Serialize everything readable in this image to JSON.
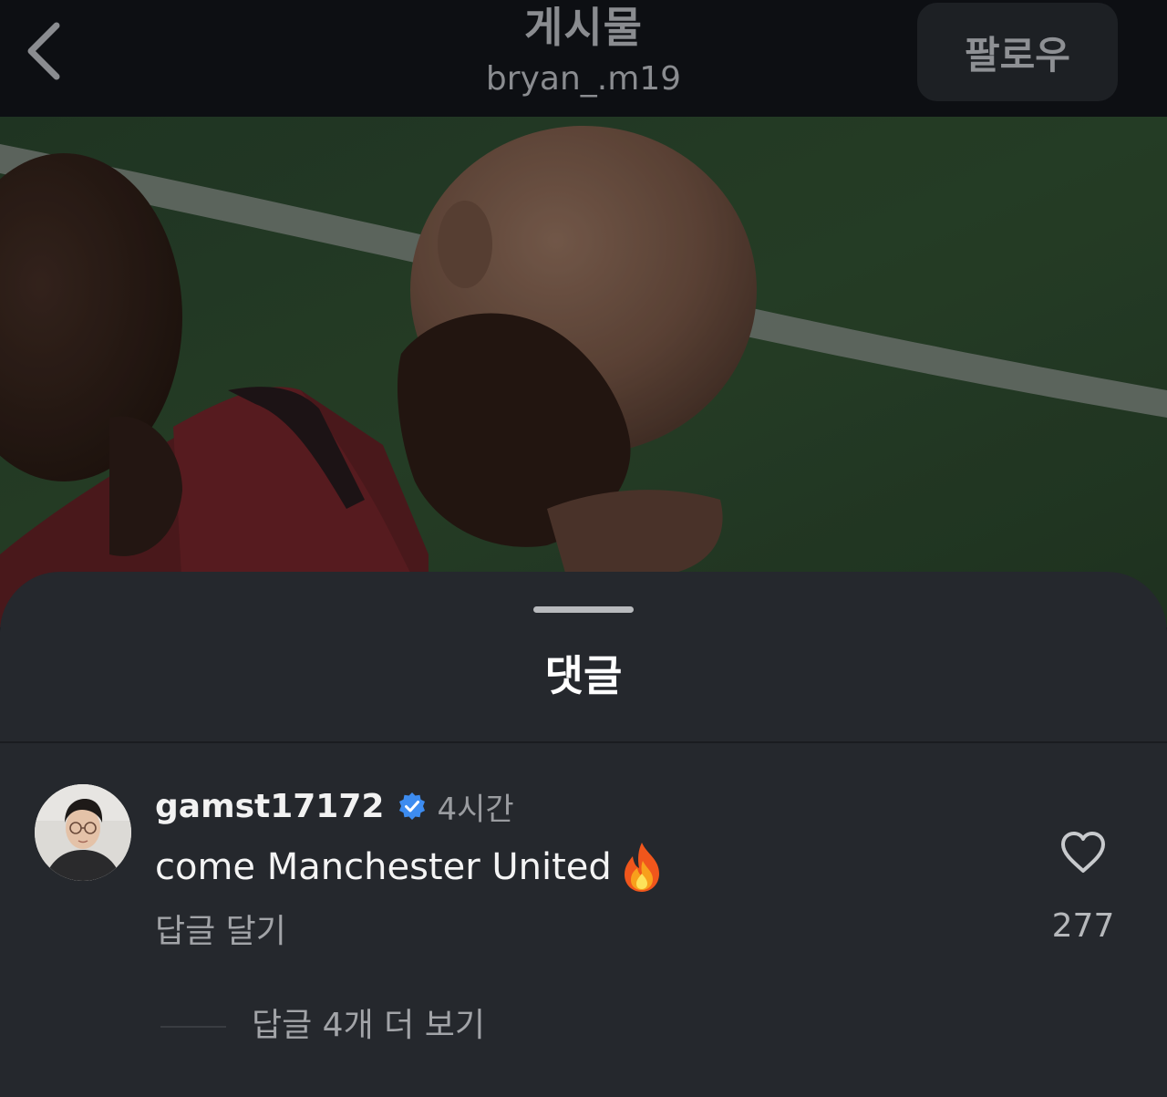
{
  "header": {
    "title": "게시물",
    "subtitle": "bryan_.m19",
    "follow_label": "팔로우",
    "back_icon": "chevron-left-icon"
  },
  "photo": {
    "description_icon": "post-photo"
  },
  "comments_sheet": {
    "title": "댓글",
    "comment": {
      "username": "gamst17172",
      "verified": true,
      "time": "4시간",
      "text": "come Manchester United",
      "emoji": "fire-icon",
      "reply_label": "답글 달기",
      "like_count": "277",
      "view_replies_label": "답글 4개 더 보기"
    }
  },
  "colors": {
    "background": "#0c0e12",
    "sheet": "#25282d",
    "verified_badge": "#3d8cf0",
    "muted_text": "#a2a4a8"
  }
}
